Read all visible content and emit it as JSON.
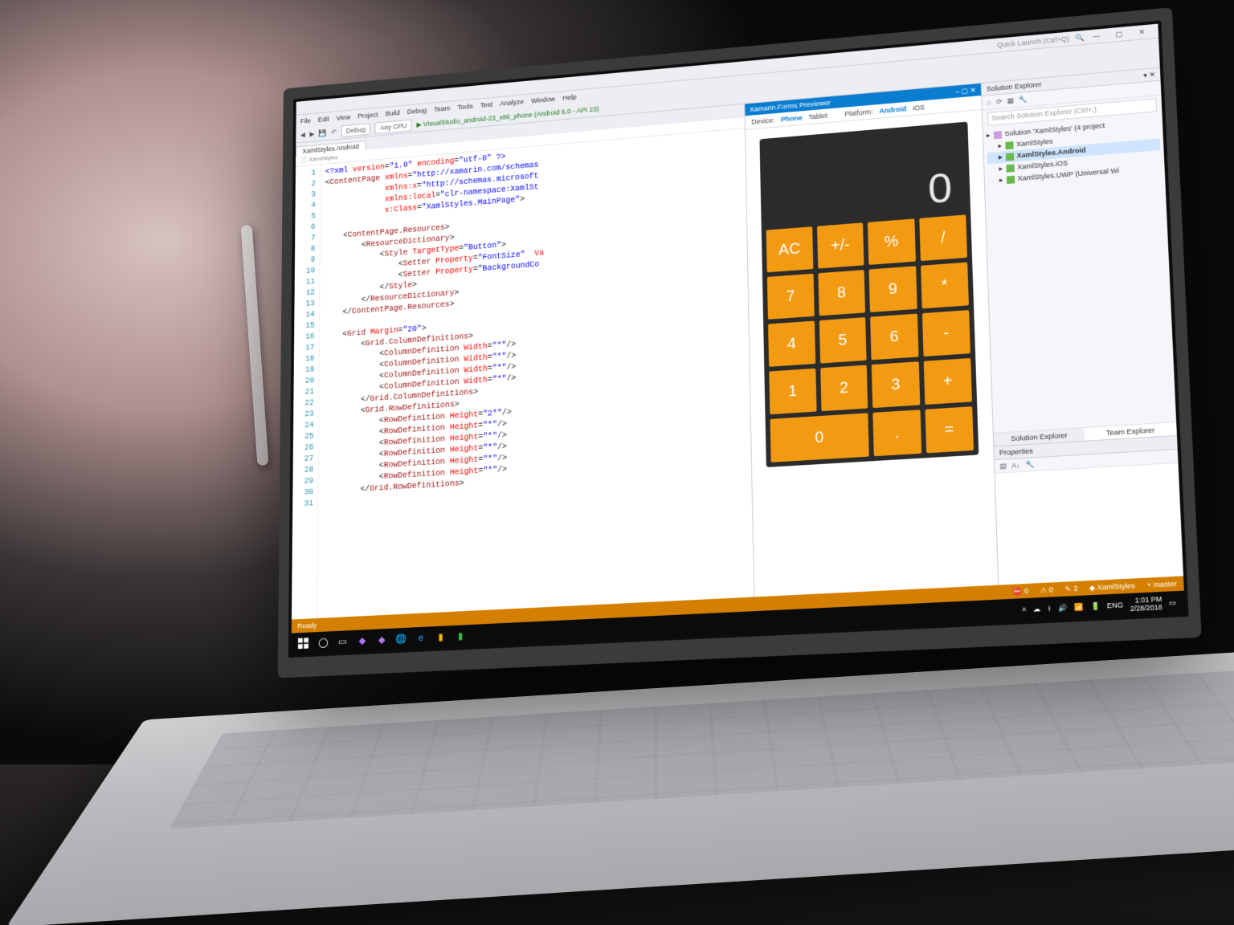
{
  "ide": {
    "quick_launch_placeholder": "Quick Launch (Ctrl+Q)",
    "menus": [
      "File",
      "Edit",
      "View",
      "Project",
      "Build",
      "Debug",
      "Team",
      "Tools",
      "Test",
      "Analyze",
      "Window",
      "Help"
    ],
    "toolbar": {
      "config": "Debug",
      "platform": "Any CPU",
      "run_target": "VisualStudio_android-23_x86_phone (Android 6.0 - API 23)"
    },
    "document_tab": "XamlStyles.Android",
    "breadcrumb": "📄 XamlStyles"
  },
  "code": {
    "lines": [
      {
        "n": 1,
        "h": "<span class='t-pi'>&lt;?xml</span> <span class='t-attr'>version</span>=<span class='t-str'>\"1.0\"</span> <span class='t-attr'>encoding</span>=<span class='t-str'>\"utf-8\"</span> <span class='t-pi'>?&gt;</span>"
      },
      {
        "n": 2,
        "h": "&lt;<span class='t-tag'>ContentPage</span> <span class='t-attr'>xmlns</span>=<span class='t-str'>\"http://xamarin.com/schemas</span>"
      },
      {
        "n": 3,
        "h": "             <span class='t-attr'>xmlns:x</span>=<span class='t-str'>\"http://schemas.microsoft</span>"
      },
      {
        "n": 4,
        "h": "             <span class='t-attr'>xmlns:local</span>=<span class='t-str'>\"clr-namespace:XamlSt</span>"
      },
      {
        "n": 5,
        "h": "             <span class='t-attr'>x:Class</span>=<span class='t-str'>\"XamlStyles.MainPage\"</span>&gt;"
      },
      {
        "n": 6,
        "h": ""
      },
      {
        "n": 7,
        "h": "    &lt;<span class='t-tag'>ContentPage.Resources</span>&gt;"
      },
      {
        "n": 8,
        "h": "        &lt;<span class='t-tag'>ResourceDictionary</span>&gt;"
      },
      {
        "n": 9,
        "h": "            &lt;<span class='t-tag'>Style</span> <span class='t-attr'>TargetType</span>=<span class='t-str'>\"Button\"</span>&gt;"
      },
      {
        "n": 10,
        "h": "                &lt;<span class='t-tag'>Setter</span> <span class='t-attr'>Property</span>=<span class='t-str'>\"FontSize\"</span>  <span class='t-attr'>Va</span>"
      },
      {
        "n": 11,
        "h": "                &lt;<span class='t-tag'>Setter</span> <span class='t-attr'>Property</span>=<span class='t-str'>\"BackgroundCo</span>"
      },
      {
        "n": 12,
        "h": "            &lt;/<span class='t-tag'>Style</span>&gt;"
      },
      {
        "n": 13,
        "h": "        &lt;/<span class='t-tag'>ResourceDictionary</span>&gt;"
      },
      {
        "n": 14,
        "h": "    &lt;/<span class='t-tag'>ContentPage.Resources</span>&gt;"
      },
      {
        "n": 15,
        "h": ""
      },
      {
        "n": 16,
        "h": "    &lt;<span class='t-tag'>Grid</span> <span class='t-attr'>Margin</span>=<span class='t-str'>\"20\"</span>&gt;"
      },
      {
        "n": 17,
        "h": "        &lt;<span class='t-tag'>Grid.ColumnDefinitions</span>&gt;"
      },
      {
        "n": 18,
        "h": "            &lt;<span class='t-tag'>ColumnDefinition</span> <span class='t-attr'>Width</span>=<span class='t-str'>\"*\"</span>/&gt;"
      },
      {
        "n": 19,
        "h": "            &lt;<span class='t-tag'>ColumnDefinition</span> <span class='t-attr'>Width</span>=<span class='t-str'>\"*\"</span>/&gt;"
      },
      {
        "n": 20,
        "h": "            &lt;<span class='t-tag'>ColumnDefinition</span> <span class='t-attr'>Width</span>=<span class='t-str'>\"*\"</span>/&gt;"
      },
      {
        "n": 21,
        "h": "            &lt;<span class='t-tag'>ColumnDefinition</span> <span class='t-attr'>Width</span>=<span class='t-str'>\"*\"</span>/&gt;"
      },
      {
        "n": 22,
        "h": "        &lt;/<span class='t-tag'>Grid.ColumnDefinitions</span>&gt;"
      },
      {
        "n": 23,
        "h": "        &lt;<span class='t-tag'>Grid.RowDefinitions</span>&gt;"
      },
      {
        "n": 24,
        "h": "            &lt;<span class='t-tag'>RowDefinition</span> <span class='t-attr'>Height</span>=<span class='t-str'>\"2*\"</span>/&gt;"
      },
      {
        "n": 25,
        "h": "            &lt;<span class='t-tag'>RowDefinition</span> <span class='t-attr'>Height</span>=<span class='t-str'>\"*\"</span>/&gt;"
      },
      {
        "n": 26,
        "h": "            &lt;<span class='t-tag'>RowDefinition</span> <span class='t-attr'>Height</span>=<span class='t-str'>\"*\"</span>/&gt;"
      },
      {
        "n": 27,
        "h": "            &lt;<span class='t-tag'>RowDefinition</span> <span class='t-attr'>Height</span>=<span class='t-str'>\"*\"</span>/&gt;"
      },
      {
        "n": 28,
        "h": "            &lt;<span class='t-tag'>RowDefinition</span> <span class='t-attr'>Height</span>=<span class='t-str'>\"*\"</span>/&gt;"
      },
      {
        "n": 29,
        "h": "            &lt;<span class='t-tag'>RowDefinition</span> <span class='t-attr'>Height</span>=<span class='t-str'>\"*\"</span>/&gt;"
      },
      {
        "n": 30,
        "h": "        &lt;/<span class='t-tag'>Grid.RowDefinitions</span>&gt;"
      },
      {
        "n": 31,
        "h": ""
      }
    ]
  },
  "previewer": {
    "title": "Xamarin.Forms Previewer",
    "device_label": "Device:",
    "device_options": [
      "Phone",
      "Tablet"
    ],
    "device_selected": "Phone",
    "platform_label": "Platform:",
    "platform_options": [
      "Android",
      "iOS"
    ],
    "platform_selected": "Android"
  },
  "calculator": {
    "display": "0",
    "buttons": [
      {
        "t": "AC"
      },
      {
        "t": "+/-"
      },
      {
        "t": "%"
      },
      {
        "t": "/"
      },
      {
        "t": "7"
      },
      {
        "t": "8"
      },
      {
        "t": "9"
      },
      {
        "t": "*"
      },
      {
        "t": "4"
      },
      {
        "t": "5"
      },
      {
        "t": "6"
      },
      {
        "t": "-"
      },
      {
        "t": "1"
      },
      {
        "t": "2"
      },
      {
        "t": "3"
      },
      {
        "t": "+"
      },
      {
        "t": "0",
        "wide": true
      },
      {
        "t": "."
      },
      {
        "t": "="
      }
    ]
  },
  "solution": {
    "panel_title": "Solution Explorer",
    "search_placeholder": "Search Solution Explorer (Ctrl+;)",
    "root": "Solution 'XamlStyles' (4 project",
    "projects": [
      {
        "name": "XamlStyles"
      },
      {
        "name": "XamlStyles.Android",
        "selected": true
      },
      {
        "name": "XamlStyles.iOS"
      },
      {
        "name": "XamlStyles.UWP (Universal Wi"
      }
    ],
    "bottom_tabs": [
      "Solution Explorer",
      "Team Explorer"
    ],
    "properties_title": "Properties"
  },
  "vs_status": {
    "left": "Ready",
    "errors": "0",
    "warnings": "0",
    "changes": "3",
    "repo": "XamlStyles",
    "branch": "master"
  },
  "taskbar": {
    "time": "1:01 PM",
    "date": "2/28/2018",
    "lang": "ENG"
  }
}
